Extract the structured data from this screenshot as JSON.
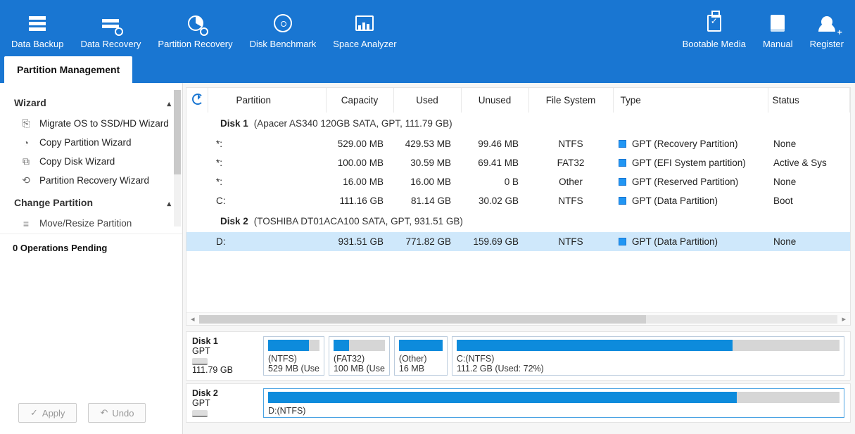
{
  "topbar": {
    "left": [
      {
        "key": "data-backup",
        "label": "Data Backup"
      },
      {
        "key": "data-recovery",
        "label": "Data Recovery"
      },
      {
        "key": "partition-recovery",
        "label": "Partition Recovery"
      },
      {
        "key": "disk-benchmark",
        "label": "Disk Benchmark"
      },
      {
        "key": "space-analyzer",
        "label": "Space Analyzer"
      }
    ],
    "right": [
      {
        "key": "bootable-media",
        "label": "Bootable Media"
      },
      {
        "key": "manual",
        "label": "Manual"
      },
      {
        "key": "register",
        "label": "Register"
      }
    ]
  },
  "tab": {
    "label": "Partition Management"
  },
  "sidebar": {
    "group1": {
      "title": "Wizard",
      "items": [
        {
          "label": "Migrate OS to SSD/HD Wizard"
        },
        {
          "label": "Copy Partition Wizard"
        },
        {
          "label": "Copy Disk Wizard"
        },
        {
          "label": "Partition Recovery Wizard"
        }
      ]
    },
    "group2": {
      "title": "Change Partition",
      "items": [
        {
          "label": "Move/Resize Partition"
        }
      ]
    },
    "pending": "0 Operations Pending",
    "apply": "Apply",
    "undo": "Undo"
  },
  "table": {
    "headers": {
      "partition": "Partition",
      "capacity": "Capacity",
      "used": "Used",
      "unused": "Unused",
      "fs": "File System",
      "type": "Type",
      "status": "Status"
    },
    "disk1": {
      "name": "Disk 1",
      "desc": "(Apacer AS340 120GB SATA, GPT, 111.79 GB)"
    },
    "disk2": {
      "name": "Disk 2",
      "desc": "(TOSHIBA DT01ACA100 SATA, GPT, 931.51 GB)"
    },
    "rows_d1": [
      {
        "p": "*:",
        "cap": "529.00 MB",
        "used": "429.53 MB",
        "unused": "99.46 MB",
        "fs": "NTFS",
        "type": "GPT (Recovery Partition)",
        "status": "None"
      },
      {
        "p": "*:",
        "cap": "100.00 MB",
        "used": "30.59 MB",
        "unused": "69.41 MB",
        "fs": "FAT32",
        "type": "GPT (EFI System partition)",
        "status": "Active & Sys"
      },
      {
        "p": "*:",
        "cap": "16.00 MB",
        "used": "16.00 MB",
        "unused": "0 B",
        "fs": "Other",
        "type": "GPT (Reserved Partition)",
        "status": "None"
      },
      {
        "p": "C:",
        "cap": "111.16 GB",
        "used": "81.14 GB",
        "unused": "30.02 GB",
        "fs": "NTFS",
        "type": "GPT (Data Partition)",
        "status": "Boot"
      }
    ],
    "rows_d2": [
      {
        "p": "D:",
        "cap": "931.51 GB",
        "used": "771.82 GB",
        "unused": "159.69 GB",
        "fs": "NTFS",
        "type": "GPT (Data Partition)",
        "status": "None"
      }
    ]
  },
  "diskbars": {
    "d1": {
      "name": "Disk 1",
      "type": "GPT",
      "size": "111.79 GB",
      "seg1": {
        "l1": "(NTFS)",
        "l2": "529 MB (Use",
        "fill": 80
      },
      "seg2": {
        "l1": "(FAT32)",
        "l2": "100 MB (Use",
        "fill": 30
      },
      "seg3": {
        "l1": "(Other)",
        "l2": "16 MB",
        "fill": 100
      },
      "seg4": {
        "l1": "C:(NTFS)",
        "l2": "111.2 GB (Used: 72%)",
        "fill": 72
      }
    },
    "d2": {
      "name": "Disk 2",
      "type": "GPT",
      "seg1": {
        "l1": "D:(NTFS)",
        "fill": 82
      }
    }
  }
}
